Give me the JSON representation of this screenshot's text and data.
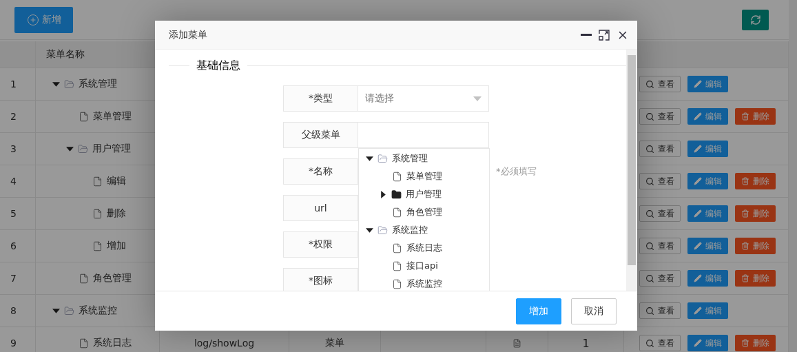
{
  "toolbar": {
    "add_button": "新增"
  },
  "table": {
    "name_column": "菜单名称",
    "rows": [
      {
        "index": "1",
        "name": "系统管理",
        "kind": "directory",
        "expanded": true,
        "actions": [
          {
            "kind": "view",
            "label": "查看"
          },
          {
            "kind": "edit",
            "label": "编辑"
          }
        ],
        "children": [
          {
            "index": "2",
            "name": "菜单管理",
            "kind": "menu",
            "actions": [
              {
                "kind": "view",
                "label": "查看"
              },
              {
                "kind": "edit",
                "label": "编辑"
              },
              {
                "kind": "delete",
                "label": "删除"
              }
            ]
          },
          {
            "index": "3",
            "name": "用户管理",
            "kind": "directory",
            "expanded": true,
            "actions": [
              {
                "kind": "view",
                "label": "查看"
              },
              {
                "kind": "edit",
                "label": "编辑"
              }
            ],
            "children": [
              {
                "index": "4",
                "name": "编辑",
                "kind": "menu",
                "actions": [
                  {
                    "kind": "view",
                    "label": "查看"
                  },
                  {
                    "kind": "edit",
                    "label": "编辑"
                  },
                  {
                    "kind": "delete",
                    "label": "删除"
                  }
                ]
              },
              {
                "index": "5",
                "name": "删除",
                "kind": "menu",
                "actions": [
                  {
                    "kind": "view",
                    "label": "查看"
                  },
                  {
                    "kind": "edit",
                    "label": "编辑"
                  },
                  {
                    "kind": "delete",
                    "label": "删除"
                  }
                ]
              },
              {
                "index": "6",
                "name": "增加",
                "kind": "menu",
                "actions": [
                  {
                    "kind": "view",
                    "label": "查看"
                  },
                  {
                    "kind": "edit",
                    "label": "编辑"
                  },
                  {
                    "kind": "delete",
                    "label": "删除"
                  }
                ]
              }
            ]
          },
          {
            "index": "7",
            "name": "角色管理",
            "kind": "menu",
            "actions": [
              {
                "kind": "view",
                "label": "查看"
              },
              {
                "kind": "edit",
                "label": "编辑"
              },
              {
                "kind": "delete",
                "label": "删除"
              }
            ]
          }
        ]
      },
      {
        "index": "8",
        "name": "系统监控",
        "kind": "directory",
        "expanded": true,
        "actions": [
          {
            "kind": "view",
            "label": "查看"
          },
          {
            "kind": "edit",
            "label": "编辑"
          }
        ],
        "children": [
          {
            "index": "9",
            "name": "系统日志",
            "kind": "menu",
            "url": "log/showLog",
            "menu_type": "菜单",
            "column_7": "1",
            "actions": [
              {
                "kind": "view",
                "label": "查看"
              },
              {
                "kind": "edit",
                "label": "编辑"
              },
              {
                "kind": "delete",
                "label": "删除"
              }
            ]
          }
        ]
      }
    ]
  },
  "dialog": {
    "title": "添加菜单",
    "section": "基础信息",
    "fields": [
      {
        "label": "*类型",
        "kind": "select",
        "placeholder": "请选择"
      },
      {
        "label": "父级菜单",
        "kind": "tree-select",
        "dropdown": [
          {
            "name": "系统管理",
            "kind": "directory",
            "expanded": true,
            "children": [
              {
                "name": "菜单管理",
                "kind": "menu"
              },
              {
                "name": "用户管理",
                "kind": "directory",
                "expanded": false
              },
              {
                "name": "角色管理",
                "kind": "menu"
              }
            ]
          },
          {
            "name": "系统监控",
            "kind": "directory",
            "expanded": true,
            "children": [
              {
                "name": "系统日志",
                "kind": "menu"
              },
              {
                "name": "接口api",
                "kind": "menu"
              },
              {
                "name": "系统监控",
                "kind": "menu"
              }
            ]
          }
        ]
      },
      {
        "label": "*名称",
        "hint": "*必须填写"
      },
      {
        "label": "url"
      },
      {
        "label": "*权限"
      },
      {
        "label": "*图标"
      }
    ],
    "buttons": [
      {
        "kind": "primary",
        "label": "增加"
      },
      {
        "kind": "default",
        "label": "取消"
      }
    ]
  }
}
